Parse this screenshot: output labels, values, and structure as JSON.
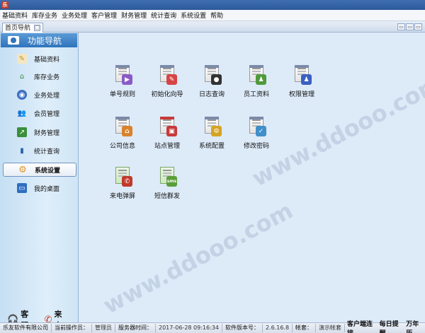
{
  "menubar": {
    "items": [
      "基础资料",
      "库存业务",
      "业务处理",
      "客户管理",
      "财务管理",
      "统计查询",
      "系统设置",
      "帮助"
    ]
  },
  "tabs": {
    "home_label": "首页导航"
  },
  "sidebar": {
    "title": "功能导航",
    "items": [
      {
        "label": "基础资料"
      },
      {
        "label": "库存业务"
      },
      {
        "label": "业务处理"
      },
      {
        "label": "会员管理"
      },
      {
        "label": "财务管理"
      },
      {
        "label": "统计查询"
      },
      {
        "label": "系统设置"
      },
      {
        "label": "我的桌面"
      }
    ],
    "active_index": 6,
    "footer": {
      "service_label": "客服",
      "call_label": "来电"
    }
  },
  "main": {
    "tiles": [
      {
        "label": "单号规则",
        "icon": "barcode-rule-icon",
        "accent": "#8a5bc7"
      },
      {
        "label": "初始化向导",
        "icon": "init-wizard-icon",
        "accent": "#d64545"
      },
      {
        "label": "日志查询",
        "icon": "log-query-icon",
        "accent": "#333333"
      },
      {
        "label": "员工资料",
        "icon": "staff-info-icon",
        "accent": "#4f9a3c"
      },
      {
        "label": "权限管理",
        "icon": "permission-icon",
        "accent": "#3b5fc4"
      },
      {
        "label": "公司信息",
        "icon": "company-info-icon",
        "accent": "#d9822b"
      },
      {
        "label": "站点管理",
        "icon": "site-manage-icon",
        "accent": "#c73a3a"
      },
      {
        "label": "系统配置",
        "icon": "system-config-icon",
        "accent": "#d6a423"
      },
      {
        "label": "修改密码",
        "icon": "change-password-icon",
        "accent": "#3f8fc9"
      },
      {
        "label": "来电弹屏",
        "icon": "caller-popup-icon",
        "accent": "#c0392b"
      },
      {
        "label": "短信群发",
        "icon": "sms-broadcast-icon",
        "accent": "#5a9e3a"
      }
    ]
  },
  "statusbar": {
    "company": "乐友软件有限公司",
    "operator_label": "当前操作员：",
    "operator_value": "管理员",
    "server_time_label": "服务器时间：",
    "server_time_value": "2017-06-28 09:16:34",
    "version_label": "软件版本号：",
    "version_value": "2.6.16.8",
    "account_label": "帐套：",
    "account_value": "演示帐套",
    "right": [
      "客户端连接",
      "每日提醒",
      "万年历"
    ]
  }
}
